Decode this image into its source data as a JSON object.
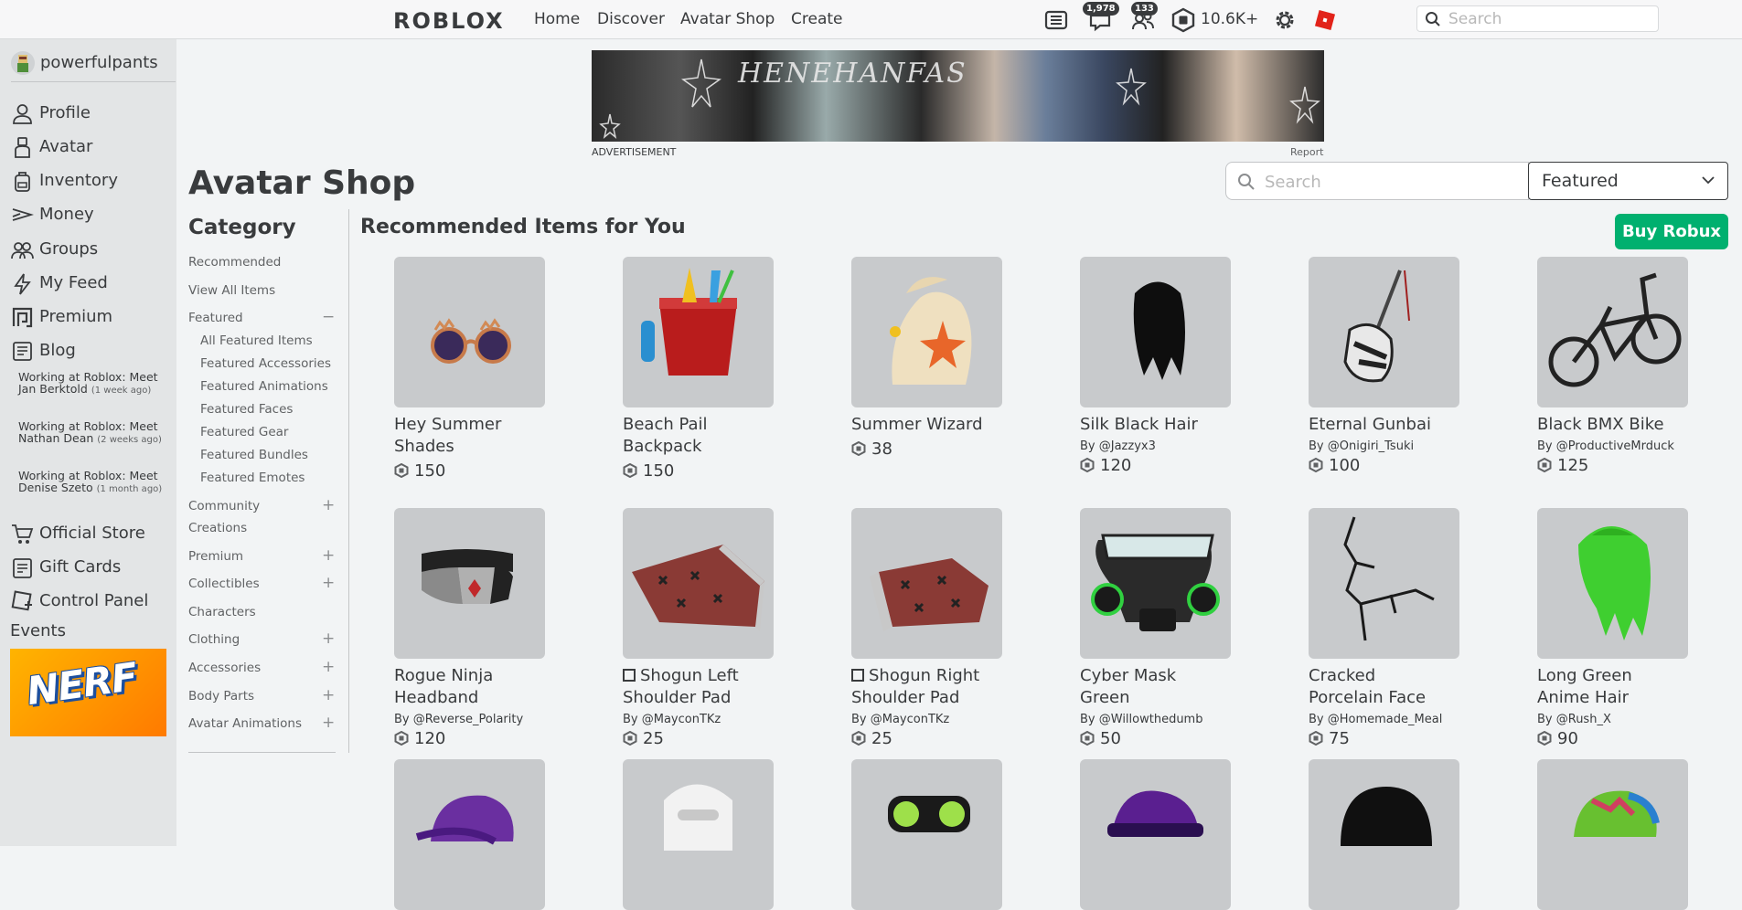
{
  "topbar": {
    "logo": "ROBLOX",
    "nav": [
      "Home",
      "Discover",
      "Avatar Shop",
      "Create"
    ],
    "messages_count": "1,978",
    "friends_count": "133",
    "robux": "10.6K+",
    "search_placeholder": "Search"
  },
  "sidebar": {
    "username": "powerfulpants",
    "items": [
      "Profile",
      "Avatar",
      "Inventory",
      "Money",
      "Groups",
      "My Feed",
      "Premium",
      "Blog"
    ],
    "blog_posts": [
      {
        "title": "Working at Roblox: Meet Jan Berktold",
        "ago": "(1 week ago)"
      },
      {
        "title": "Working at Roblox: Meet Nathan Dean",
        "ago": "(2 weeks ago)"
      },
      {
        "title": "Working at Roblox: Meet Denise Szeto",
        "ago": "(1 month ago)"
      }
    ],
    "store_items": [
      "Official Store",
      "Gift Cards",
      "Control Panel"
    ],
    "events_label": "Events",
    "event_banner": "NERF"
  },
  "ad": {
    "label": "ADVERTISEMENT",
    "report": "Report",
    "banner_text": "HENEHANFAS"
  },
  "page": {
    "title": "Avatar Shop",
    "search_placeholder": "Search",
    "sort_selected": "Featured",
    "section_title": "Recommended Items for You",
    "buy_robux": "Buy Robux"
  },
  "category": {
    "title": "Category",
    "items": [
      "Recommended",
      "View All Items",
      "Featured"
    ],
    "featured_sub": [
      "All Featured Items",
      "Featured Accessories",
      "Featured Animations",
      "Featured Faces",
      "Featured Gear",
      "Featured Bundles",
      "Featured Emotes"
    ],
    "community_line1": "Community",
    "community_line2": "Creations",
    "rest": [
      "Premium",
      "Collectibles",
      "Characters",
      "Clothing",
      "Accessories",
      "Body Parts",
      "Avatar Animations"
    ],
    "toggle_minus": "−",
    "toggle_plus": "+"
  },
  "items": [
    {
      "line1": "Hey Summer",
      "line2": "Shades",
      "creator": "",
      "price": "150"
    },
    {
      "line1": "Beach Pail",
      "line2": "Backpack",
      "creator": "",
      "price": "150"
    },
    {
      "line1": "Summer Wizard",
      "line2": "",
      "creator": "",
      "price": "38"
    },
    {
      "line1": "Silk Black Hair",
      "line2": "",
      "creator": "By @Jazzyx3",
      "price": "120"
    },
    {
      "line1": "Eternal Gunbai",
      "line2": "",
      "creator": "By @Onigiri_Tsuki",
      "price": "100"
    },
    {
      "line1": "Black BMX Bike",
      "line2": "",
      "creator": "By @ProductiveMrduck",
      "price": "125"
    },
    {
      "line1": "Rogue Ninja",
      "line2": "Headband",
      "creator": "By @Reverse_Polarity",
      "price": "120"
    },
    {
      "line1": "Shogun Left",
      "line2": "Shoulder Pad",
      "creator": "By @MayconTKz",
      "price": "25"
    },
    {
      "line1": "Shogun Right",
      "line2": "Shoulder Pad",
      "creator": "By @MayconTKz",
      "price": "25"
    },
    {
      "line1": "Cyber Mask",
      "line2": "Green",
      "creator": "By @Willowthedumb",
      "price": "50"
    },
    {
      "line1": "Cracked",
      "line2": "Porcelain Face",
      "creator": "By @Homemade_Meal",
      "price": "75"
    },
    {
      "line1": "Long Green",
      "line2": "Anime Hair",
      "creator": "By @Rush_X",
      "price": "90"
    }
  ],
  "colors": {
    "accent_green": "#00b06f",
    "text": "#393b3d",
    "thumb_bg": "#c8cacc"
  }
}
